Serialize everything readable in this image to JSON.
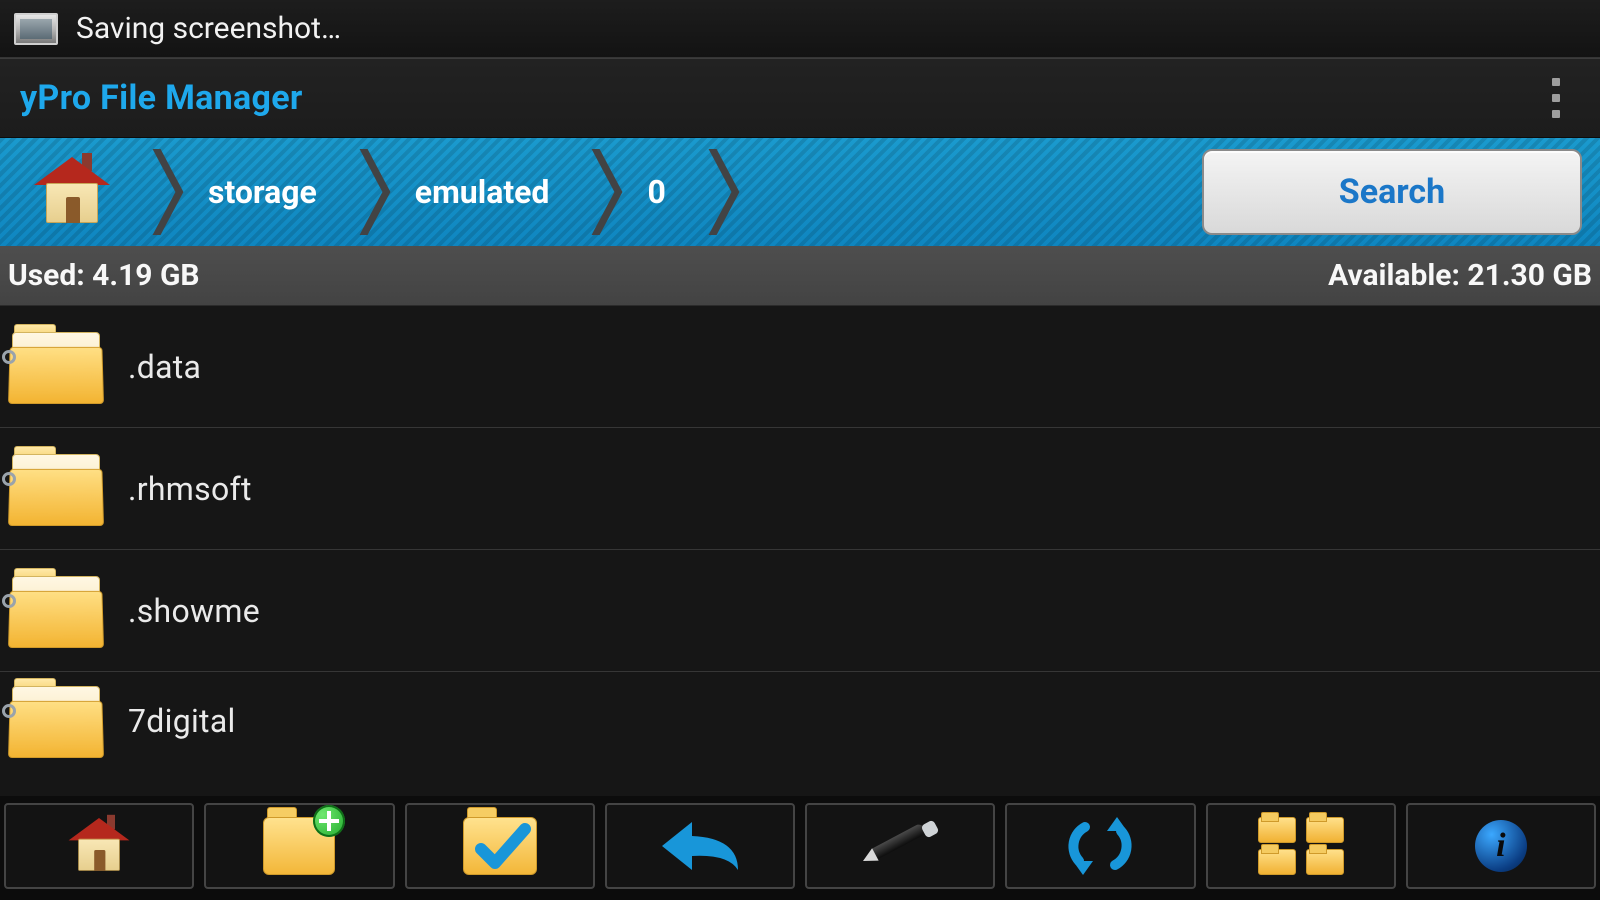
{
  "status_bar": {
    "text": "Saving screenshot…"
  },
  "app": {
    "title": "yPro File Manager"
  },
  "breadcrumb": {
    "items": [
      "storage",
      "emulated",
      "0"
    ],
    "search_label": "Search"
  },
  "storage": {
    "used_label": "Used: 4.19 GB",
    "available_label": "Available: 21.30 GB"
  },
  "files": [
    {
      "name": ".data"
    },
    {
      "name": ".rhmsoft"
    },
    {
      "name": ".showme"
    },
    {
      "name": "7digital"
    }
  ],
  "toolbar": {
    "home": "Home",
    "new_folder": "New folder",
    "select": "Select",
    "back": "Back",
    "edit": "Edit",
    "refresh": "Refresh",
    "multi": "Multi-select",
    "info": "Info"
  }
}
